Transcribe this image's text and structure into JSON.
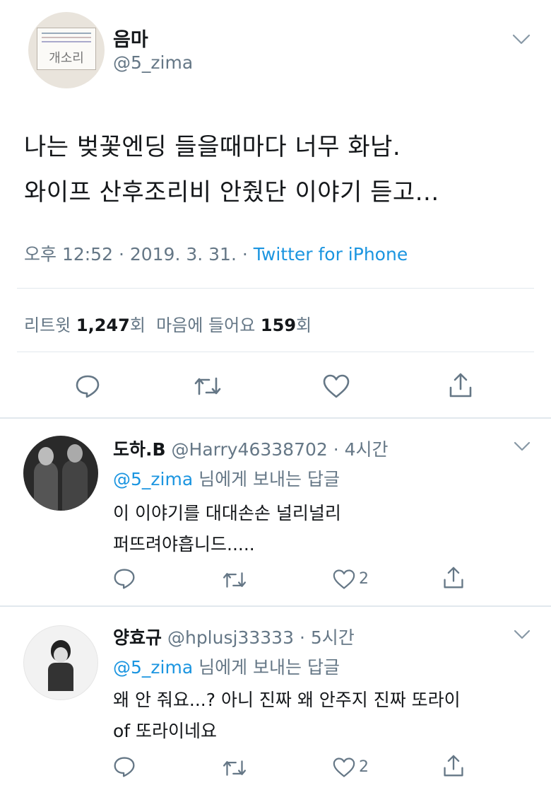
{
  "main_tweet": {
    "display_name": "음마",
    "handle": "@5_zima",
    "avatar_text": "개소리",
    "text_line1": "나는 벚꽃엔딩 들을때마다 너무 화남.",
    "text_line2": "와이프 산후조리비 안줬단 이야기 듣고...",
    "time_date": "오후 12:52 · 2019. 3. 31. · ",
    "source": "Twitter for iPhone",
    "retweet_label": "리트윗",
    "retweet_count": "1,247",
    "retweet_unit": "회",
    "like_label": "마음에 들어요",
    "like_count": "159",
    "like_unit": "회"
  },
  "replies": [
    {
      "display_name": "도하.B",
      "handle": "@Harry46338702",
      "time": "· 4시간",
      "reply_to_handle": "@5_zima",
      "reply_to_rest": "님에게 보내는 답글",
      "text_line1": "이 이야기를 대대손손 널리널리",
      "text_line2": "퍼뜨려야흡니드.....",
      "like_count": "2"
    },
    {
      "display_name": "양효규",
      "handle": "@hplusj33333",
      "time": "· 5시간",
      "reply_to_handle": "@5_zima",
      "reply_to_rest": "님에게 보내는 답글",
      "text_line1": "왜 안 줘요...? 아니 진짜 왜 안주지 진짜 또라이",
      "text_line2": "of 또라이네요",
      "like_count": "2"
    }
  ],
  "icons": [
    "chevron-down-icon",
    "reply-icon",
    "retweet-icon",
    "like-icon",
    "share-icon"
  ],
  "colors": {
    "text": "#14171a",
    "muted": "#657786",
    "link": "#1b95e0",
    "divider": "#e1e8ed"
  }
}
